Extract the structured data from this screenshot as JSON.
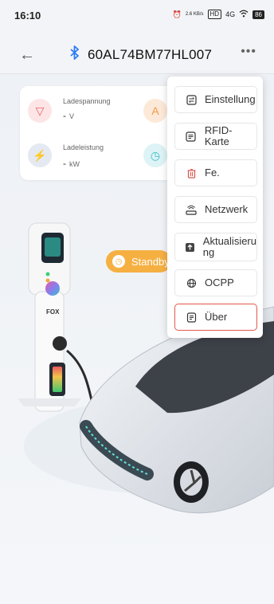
{
  "status_bar": {
    "time": "16:10",
    "network_speed": "2.6 KB/s",
    "signal": "4G",
    "battery": "86"
  },
  "header": {
    "back_icon": "arrow-left-icon",
    "bluetooth_icon": "bluetooth-icon",
    "device_id": "60AL74BM77HL007",
    "more_icon": "more-dots-icon"
  },
  "metrics": [
    {
      "label": "Ladespannung",
      "value": "-",
      "unit": "V",
      "icon": "voltage-icon",
      "color": "#e8626a"
    },
    {
      "label": "",
      "value": "-",
      "unit": "A",
      "icon": "current-icon",
      "color": "#f29a4b"
    },
    {
      "label": "Ladeleistung",
      "value": "-",
      "unit": "kW",
      "icon": "power-icon",
      "color": "#5c7fb5"
    },
    {
      "label": "",
      "value": "",
      "unit": "",
      "icon": "clock-icon",
      "color": "#3cbcc7"
    }
  ],
  "menu": {
    "items": [
      {
        "label": "Einstellung",
        "icon": "settings-icon"
      },
      {
        "label": "RFID-Karte",
        "icon": "card-icon"
      },
      {
        "label": "Fe.",
        "icon": "trash-icon"
      },
      {
        "label": "Netzwerk",
        "icon": "router-icon"
      },
      {
        "label": "Aktualisierung",
        "label_line1": "Aktualisieru",
        "label_line2": "ng",
        "icon": "upgrade-icon"
      },
      {
        "label": "OCPP",
        "icon": "globe-icon"
      },
      {
        "label": "Über",
        "icon": "info-doc-icon",
        "selected": true
      }
    ]
  },
  "charger": {
    "brand_logo": "FOX",
    "status_text": "Standby",
    "status_color": "#f6b042"
  },
  "colors": {
    "accent": "#2b7cf6",
    "selected_border": "#e2584b"
  }
}
